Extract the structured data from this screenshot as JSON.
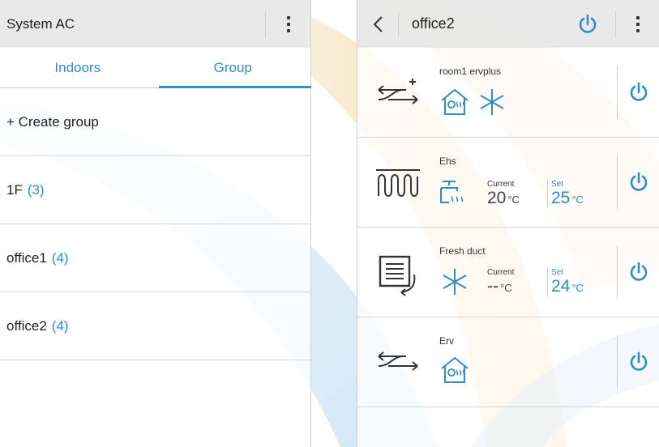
{
  "colors": {
    "accent": "#2e8ec8",
    "appbar_bg": "#e6e6e6",
    "bg_arc_orange": "#f5b84a",
    "bg_arc_blue": "#8ec6ea"
  },
  "left": {
    "title": "System AC",
    "tabs": [
      {
        "label": "Indoors",
        "selected": false
      },
      {
        "label": "Group",
        "selected": true
      }
    ],
    "create_group_label": "+ Create group",
    "groups": [
      {
        "name": "1F",
        "count": "(3)"
      },
      {
        "name": "office1",
        "count": "(4)"
      },
      {
        "name": "office2",
        "count": "(4)"
      }
    ]
  },
  "right": {
    "title": "office2",
    "devices": [
      {
        "name": "room1 ervplus",
        "icon": "erv-plus-icon",
        "modes": [
          "fan-heat-icon",
          "cool-snowflake-icon"
        ]
      },
      {
        "name": "Ehs",
        "icon": "heater-coil-icon",
        "mode": "water-heat-icon",
        "current_label": "Current",
        "current_value": "20",
        "current_unit": "°C",
        "set_label": "Set",
        "set_value": "25",
        "set_unit": "°C"
      },
      {
        "name": "Fresh  duct",
        "icon": "duct-icon",
        "mode": "cool-snowflake-icon",
        "current_label": "Current",
        "current_value": "--",
        "current_unit": "°C",
        "set_label": "Set",
        "set_value": "24",
        "set_unit": "°C"
      },
      {
        "name": "Erv",
        "icon": "erv-icon",
        "mode": "fan-heat-icon"
      }
    ]
  }
}
